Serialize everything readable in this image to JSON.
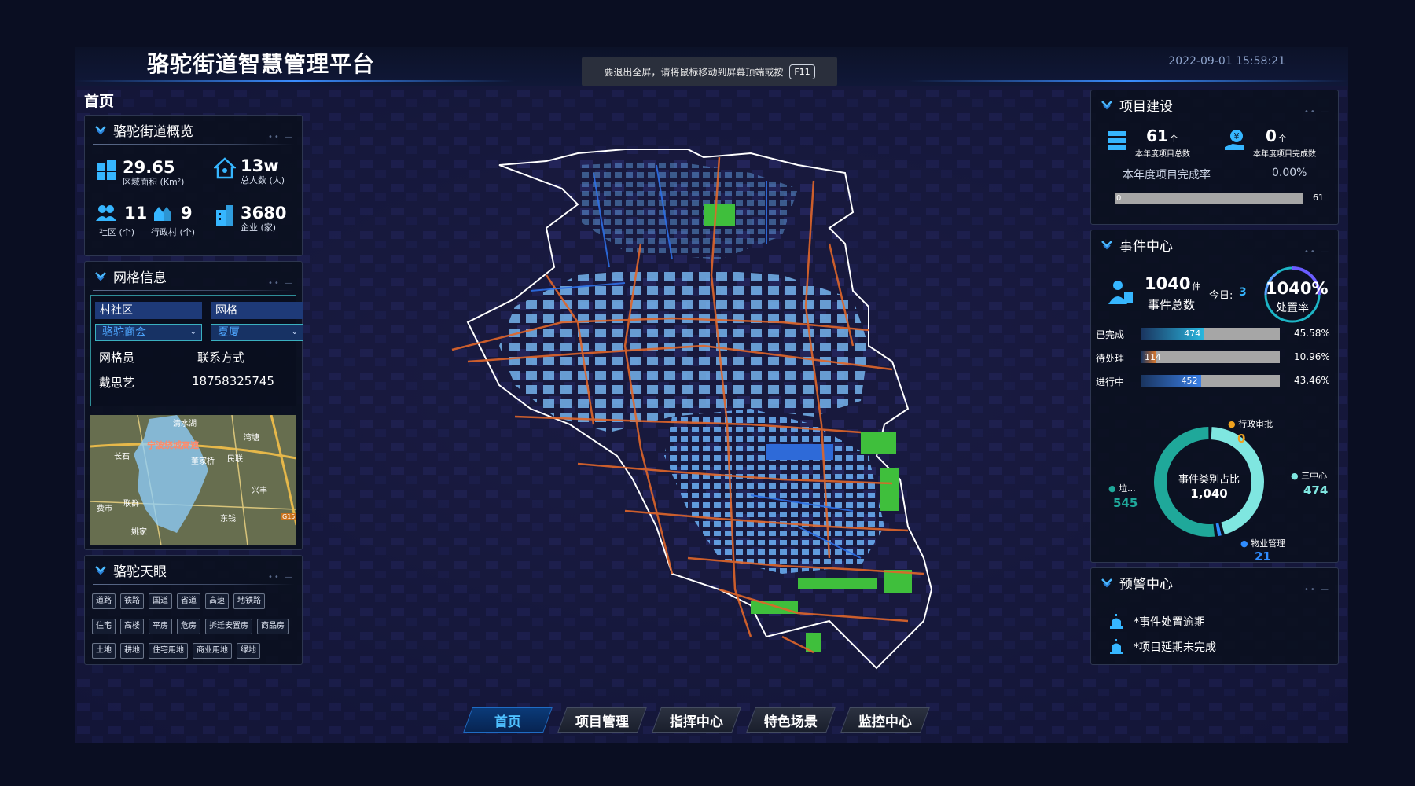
{
  "header": {
    "title": "骆驼街道智慧管理平台",
    "datetime": "2022-09-01 15:58:21",
    "fullscreen_tip": "要退出全屏，请将鼠标移动到屏幕顶端或按",
    "fullscreen_key": "F11",
    "page_label": "首页"
  },
  "overview": {
    "title": "骆驼街道概览",
    "area": {
      "value": "29.65",
      "label": "区域面积 (Km²)",
      "icon": "building-blocks-icon"
    },
    "population": {
      "value": "13w",
      "label": "总人数 (人)",
      "icon": "house-icon"
    },
    "communities": {
      "value": "11",
      "label": "社区 (个)",
      "icon": "people-icon"
    },
    "villages": {
      "value": "9",
      "label": "行政村 (个)",
      "icon": "village-icon"
    },
    "enterprises": {
      "value": "3680",
      "label": "企业 (家)",
      "icon": "office-building-icon"
    }
  },
  "grid": {
    "title": "网格信息",
    "col1_header": "村社区",
    "col2_header": "网格",
    "col1_value": "骆驼商会",
    "col2_value": "夏厦",
    "staff_label": "网格员",
    "contact_label": "联系方式",
    "staff_name": "戴思艺",
    "phone": "18758325745",
    "map_labels": [
      "清水湖",
      "宁波绕城高速",
      "长石",
      "湾塘",
      "董家桥",
      "民联",
      "兴丰",
      "费市",
      "联群",
      "东钱",
      "姚家",
      "G15"
    ]
  },
  "eye": {
    "title": "骆驼天眼",
    "row1": [
      "道路",
      "铁路",
      "国道",
      "省道",
      "高速",
      "地铁路"
    ],
    "row2": [
      "住宅",
      "高楼",
      "平房",
      "危房",
      "拆迁安置房",
      "商品房"
    ],
    "row3": [
      "土地",
      "耕地",
      "住宅用地",
      "商业用地",
      "绿地"
    ]
  },
  "project": {
    "title": "项目建设",
    "total_value": "61",
    "total_unit": "个",
    "total_label": "本年度项目总数",
    "done_value": "0",
    "done_unit": "个",
    "done_label": "本年度项目完成数",
    "rate_label": "本年度项目完成率",
    "rate_value": "0.00%",
    "progress_min": "0",
    "progress_max": "61",
    "progress_fraction": 0
  },
  "events": {
    "title": "事件中心",
    "total_value": "1040",
    "total_unit": "件",
    "total_label": "事件总数",
    "today_label": "今日:",
    "today_value": "3",
    "rate_value": "1040%",
    "rate_label": "处置率",
    "status": [
      {
        "label": "已完成",
        "value": "474",
        "pct": "45.58%",
        "fraction": 0.4558,
        "color": "#29b8e0"
      },
      {
        "label": "待处理",
        "value": "114",
        "pct": "10.96%",
        "fraction": 0.1096,
        "color": "#e07a2c"
      },
      {
        "label": "进行中",
        "value": "452",
        "pct": "43.46%",
        "fraction": 0.4346,
        "color": "#3a7fe6"
      }
    ],
    "donut_title": "事件类别占比",
    "donut_total": "1,040",
    "categories": [
      {
        "name": "行政审批",
        "value": "0",
        "color": "#f0a21e"
      },
      {
        "name": "三中心",
        "value": "474",
        "color": "#7fe6e0"
      },
      {
        "name": "物业管理",
        "value": "21",
        "color": "#2f8cff"
      },
      {
        "name": "垃...",
        "value": "545",
        "color": "#1fa89a"
      }
    ]
  },
  "warning": {
    "title": "预警中心",
    "items": [
      "*事件处置逾期",
      "*项目延期未完成"
    ]
  },
  "nav": {
    "tabs": [
      "首页",
      "项目管理",
      "指挥中心",
      "特色场景",
      "监控中心"
    ],
    "active": 0
  }
}
